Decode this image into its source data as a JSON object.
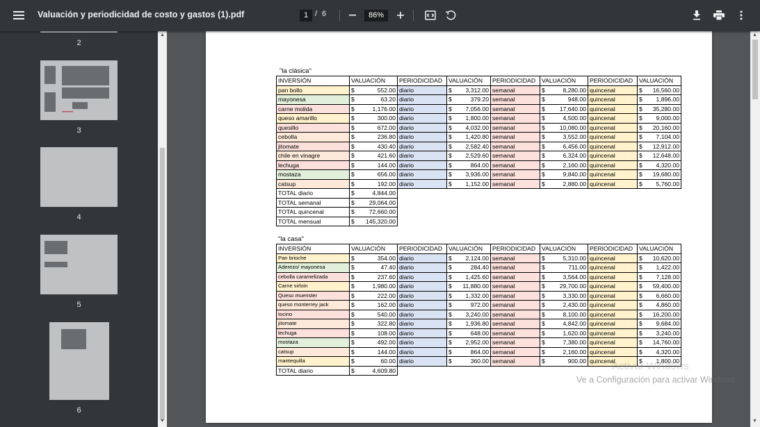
{
  "toolbar": {
    "title": "Valuación y periodicidad de costo y gastos (1).pdf",
    "current_page": "1",
    "separator": "/",
    "total_pages": "6",
    "zoom": "86%"
  },
  "sidebar": {
    "thumbnails": [
      {
        "label": "2"
      },
      {
        "label": "3"
      },
      {
        "label": "4"
      },
      {
        "label": "5"
      },
      {
        "label": "6"
      }
    ]
  },
  "headers": {
    "item": "INVERSIÓN",
    "val": "VALUACIÓN",
    "per": "PERIODICIDAD"
  },
  "clasica": {
    "caption": "\"la clásica\"",
    "rows": [
      {
        "item": "pan bollo",
        "v1": "552.00",
        "p1": "diario",
        "v2": "3,312.00",
        "p2": "semanal",
        "v3": "8,280.00",
        "p3": "quincenal",
        "v4": "16,560.00"
      },
      {
        "item": "mayonesa",
        "v1": "63.20",
        "p1": "diario",
        "v2": "379.20",
        "p2": "semanal",
        "v3": "948.00",
        "p3": "quincenal",
        "v4": "1,896.00"
      },
      {
        "item": "carne molida",
        "v1": "1,176.00",
        "p1": "diario",
        "v2": "7,056.00",
        "p2": "semanal",
        "v3": "17,640.00",
        "p3": "quincenal",
        "v4": "35,280.00"
      },
      {
        "item": "queso amarillo",
        "v1": "300.00",
        "p1": "diario",
        "v2": "1,800.00",
        "p2": "semanal",
        "v3": "4,500.00",
        "p3": "quincenal",
        "v4": "9,000.00"
      },
      {
        "item": "quesillo",
        "v1": "672.00",
        "p1": "diario",
        "v2": "4,032.00",
        "p2": "semanal",
        "v3": "10,080.00",
        "p3": "quincenal",
        "v4": "20,160.00"
      },
      {
        "item": "cebolla",
        "v1": "236.80",
        "p1": "diario",
        "v2": "1,420.80",
        "p2": "semanal",
        "v3": "3,552.00",
        "p3": "quincenal",
        "v4": "7,104.00"
      },
      {
        "item": "jitomate",
        "v1": "430.40",
        "p1": "diario",
        "v2": "2,582.40",
        "p2": "semanal",
        "v3": "6,456.00",
        "p3": "quincenal",
        "v4": "12,912.00"
      },
      {
        "item": "chile en vinagre",
        "v1": "421.60",
        "p1": "diario",
        "v2": "2,529.60",
        "p2": "semanal",
        "v3": "6,324.00",
        "p3": "quincenal",
        "v4": "12,648.00"
      },
      {
        "item": "lechuga",
        "v1": "144.00",
        "p1": "diario",
        "v2": "864.00",
        "p2": "semanal",
        "v3": "2,160.00",
        "p3": "quincenal",
        "v4": "4,320.00"
      },
      {
        "item": "mostaza",
        "v1": "656.00",
        "p1": "diario",
        "v2": "3,936.00",
        "p2": "semanal",
        "v3": "9,840.00",
        "p3": "quincenal",
        "v4": "19,680.00"
      },
      {
        "item": "catsup",
        "v1": "192.00",
        "p1": "diario",
        "v2": "1,152.00",
        "p2": "semanal",
        "v3": "2,880.00",
        "p3": "quincenal",
        "v4": "5,760.00"
      }
    ],
    "totals": [
      {
        "label": "TOTAL diario",
        "value": "4,844.00"
      },
      {
        "label": "TOTAL semanal",
        "value": "29,064.00"
      },
      {
        "label": "TOTAL quincenal",
        "value": "72,660.00"
      },
      {
        "label": "TOTAL mensual",
        "value": "145,320.00"
      }
    ]
  },
  "casa": {
    "caption": "\"la casa\"",
    "rows": [
      {
        "item": "Pan brioche",
        "v1": "354.00",
        "p1": "diario",
        "v2": "2,124.00",
        "p2": "semanal",
        "v3": "5,310.00",
        "p3": "quincenal",
        "v4": "10,620.00"
      },
      {
        "item": "Aderezo/ mayonesa",
        "v1": "47.40",
        "p1": "diario",
        "v2": "284.40",
        "p2": "semanal",
        "v3": "711.00",
        "p3": "quincenal",
        "v4": "1,422.00"
      },
      {
        "item": "cebolla caramelizada",
        "v1": "237.60",
        "p1": "diario",
        "v2": "1,425.60",
        "p2": "semanal",
        "v3": "3,564.00",
        "p3": "quincenal",
        "v4": "7,128.00"
      },
      {
        "item": "Carne sirloin",
        "v1": "1,980.00",
        "p1": "diario",
        "v2": "11,880.00",
        "p2": "semanal",
        "v3": "29,700.00",
        "p3": "quincenal",
        "v4": "59,400.00"
      },
      {
        "item": "Queso muenster",
        "v1": "222.00",
        "p1": "diario",
        "v2": "1,332.00",
        "p2": "semanal",
        "v3": "3,330.00",
        "p3": "quincenal",
        "v4": "6,660.00"
      },
      {
        "item": "queso monterrey jack",
        "v1": "162.00",
        "p1": "diario",
        "v2": "972.00",
        "p2": "semanal",
        "v3": "2,430.00",
        "p3": "quincenal",
        "v4": "4,860.00"
      },
      {
        "item": "tocino",
        "v1": "540.00",
        "p1": "diario",
        "v2": "3,240.00",
        "p2": "semanal",
        "v3": "8,100.00",
        "p3": "quincenal",
        "v4": "16,200.00"
      },
      {
        "item": "jitomate",
        "v1": "322.80",
        "p1": "diario",
        "v2": "1,936.80",
        "p2": "semanal",
        "v3": "4,842.00",
        "p3": "quincenal",
        "v4": "9,684.00"
      },
      {
        "item": "lechuga",
        "v1": "108.00",
        "p1": "diario",
        "v2": "648.00",
        "p2": "semanal",
        "v3": "1,620.00",
        "p3": "quincenal",
        "v4": "3,240.00"
      },
      {
        "item": "mostaza",
        "v1": "492.00",
        "p1": "diario",
        "v2": "2,952.00",
        "p2": "semanal",
        "v3": "7,380.00",
        "p3": "quincenal",
        "v4": "14,760.00"
      },
      {
        "item": "catsup",
        "v1": "144.00",
        "p1": "diario",
        "v2": "864.00",
        "p2": "semanal",
        "v3": "2,160.00",
        "p3": "quincenal",
        "v4": "4,320.00"
      },
      {
        "item": "mantequilla",
        "v1": "60.00",
        "p1": "diario",
        "v2": "360.00",
        "p2": "semanal",
        "v3": "900.00",
        "p3": "quincenal",
        "v4": "1,800.00"
      }
    ],
    "totals": [
      {
        "label": "TOTAL diario",
        "value": "4,609.80"
      }
    ]
  },
  "currency": "$",
  "row_colors": [
    "#fff2cc",
    "#e2efda",
    "#fbe0dc",
    "#fff2cc",
    "#fbe0dc",
    "#fde9d9",
    "#fbe0dc",
    "#fde9d9",
    "#fbe0dc",
    "#e2efda",
    "#fde9d9",
    "#fff2cc"
  ],
  "watermark": {
    "line1": "Activar Windows",
    "line2": "Ve a Configuración para activar Windows."
  }
}
